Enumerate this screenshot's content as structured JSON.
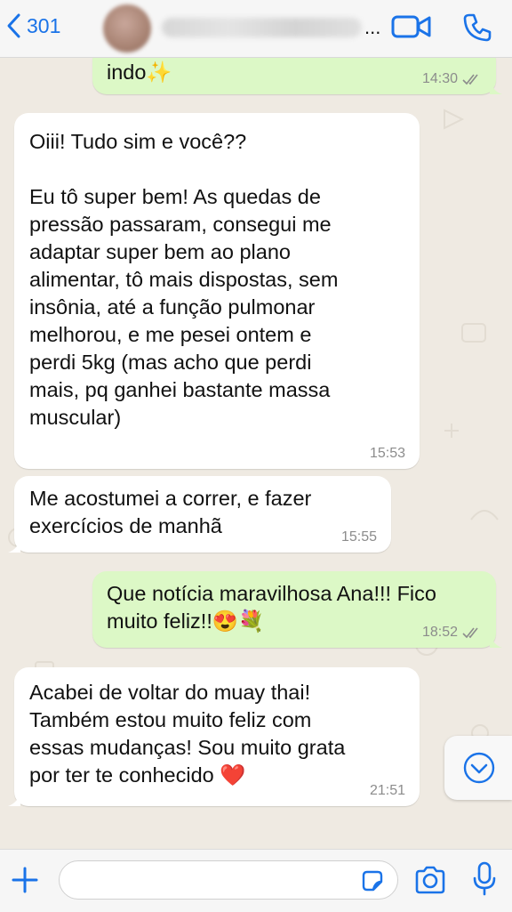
{
  "header": {
    "back_count": "301",
    "name_ellipsis": "..."
  },
  "messages": [
    {
      "direction": "out",
      "text": "indo✨",
      "time": "14:30",
      "read": true
    },
    {
      "direction": "in",
      "text": "Oiii! Tudo sim e você??\n\nEu tô super bem! As quedas de\npressão passaram, consegui me\nadaptar super bem ao plano\nalimentar, tô mais dispostas, sem\ninsônia, até a função pulmonar\nmelhorou, e me pesei ontem e\nperdi 5kg (mas acho que perdi\nmais, pq ganhei bastante massa\nmuscular)",
      "time": "15:53"
    },
    {
      "direction": "in",
      "text": "Me acostumei a correr, e fazer\nexercícios de manhã",
      "time": "15:55"
    },
    {
      "direction": "out",
      "text": "Que notícia maravilhosa Ana!!! Fico\nmuito feliz!!😍💐",
      "time": "18:52",
      "read": true
    },
    {
      "direction": "in",
      "text": "Acabei de voltar do muay thai!\nTambém estou muito feliz com\nessas mudanças! Sou muito grata\npor ter te conhecido ❤️",
      "time": "21:51"
    }
  ],
  "input": {
    "placeholder": ""
  },
  "icons": {
    "back": "chevron-left-icon",
    "video": "video-camera-icon",
    "call": "phone-icon",
    "scroll": "chevron-down-circle-icon",
    "plus": "plus-icon",
    "sticker": "sticker-icon",
    "camera": "camera-icon",
    "mic": "microphone-icon"
  },
  "colors": {
    "accent": "#1a73e8",
    "outgoing_bubble": "#dcf8c6",
    "incoming_bubble": "#ffffff",
    "read_ticks": "#8c8c8c"
  }
}
